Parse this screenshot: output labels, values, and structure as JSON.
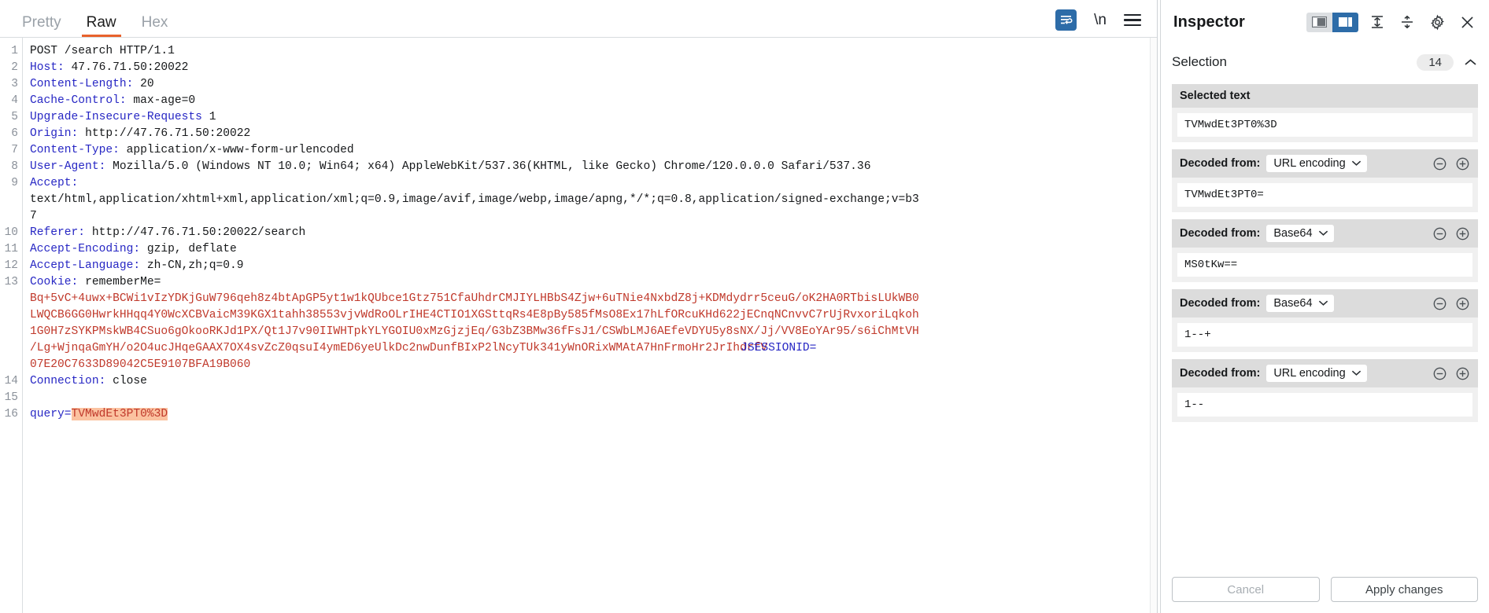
{
  "editor": {
    "tabs": [
      {
        "label": "Pretty",
        "active": false
      },
      {
        "label": "Raw",
        "active": true
      },
      {
        "label": "Hex",
        "active": false
      }
    ],
    "tools": {
      "wrap_icon": "word-wrap-icon",
      "newline_label": "\\n",
      "menu_icon": "hamburger-menu-icon"
    },
    "accent_color": "#e8622c",
    "gutter_numbers": [
      "1",
      "2",
      "3",
      "4",
      "5",
      "6",
      "7",
      "8",
      "9",
      "",
      "10",
      "11",
      "12",
      "13",
      "",
      "",
      "",
      "",
      "14",
      "15",
      "16"
    ],
    "lines": [
      {
        "n": "1",
        "type": "request",
        "method": "POST /search HTTP/1.1"
      },
      {
        "n": "2",
        "type": "header",
        "name": "Host:",
        "value": " 47.76.71.50:20022"
      },
      {
        "n": "3",
        "type": "header",
        "name": "Content-Length:",
        "value": " 20"
      },
      {
        "n": "4",
        "type": "header",
        "name": "Cache-Control:",
        "value": " max-age=0"
      },
      {
        "n": "5",
        "type": "header",
        "name": "Upgrade-Insecure-Requests",
        "value": " 1"
      },
      {
        "n": "6",
        "type": "header",
        "name": "Origin:",
        "value": " http://47.76.71.50:20022"
      },
      {
        "n": "7",
        "type": "header",
        "name": "Content-Type:",
        "value": " application/x-www-form-urlencoded"
      },
      {
        "n": "8",
        "type": "header",
        "name": "User-Agent:",
        "value": " Mozilla/5.0 (Windows NT 10.0; Win64; x64) AppleWebKit/537.36(KHTML, like Gecko) Chrome/120.0.0.0 Safari/537.36"
      },
      {
        "n": "9",
        "type": "header",
        "name": "Accept:",
        "value": ""
      },
      {
        "n": "",
        "type": "cont",
        "value": "text/html,application/xhtml+xml,application/xml;q=0.9,image/avif,image/webp,image/apng,*/*;q=0.8,application/signed-exchange;v=b3"
      },
      {
        "n": "",
        "type": "cont",
        "value": "7"
      },
      {
        "n": "10",
        "type": "header",
        "name": "Referer:",
        "value": " http://47.76.71.50:20022/search"
      },
      {
        "n": "11",
        "type": "header",
        "name": "Accept-Encoding:",
        "value": " gzip, deflate"
      },
      {
        "n": "12",
        "type": "header",
        "name": "Accept-Language:",
        "value": " zh-CN,zh;q=0.9"
      },
      {
        "n": "13",
        "type": "header",
        "name": "Cookie:",
        "value": " rememberMe="
      }
    ],
    "cookie_lines": [
      "Bq+5vC+4uwx+BCWi1vIzYDKjGuW796qeh8z4btApGP5yt1w1kQUbce1Gtz751CfaUhdrCMJIYLHBbS4Zjw+6uTNie4NxbdZ8j+KDMdydrr5ceuG/oK2HA0RTbisLUkWB0",
      "LWQCB6GG0HwrkHHqq4Y0WcXCBVaicM39KGX1tahh38553vjvWdRoOLrIHE4CTIO1XGSttqRs4E8pBy585fMsO8Ex17hLfORcuKHd622jECnqNCnvvC7rUjRvxoriLqkoh",
      "1G0H7zSYKPMskWB4CSuo6gOkooRKJd1PX/Qt1J7v90IIWHTpkYLYGOIU0xMzGjzjEq/G3bZ3BMw36fFsJ1/CSWbLMJ6AEfeVDYU5y8sNX/Jj/VV8EoYAr95/s6iChMtVH",
      "/Lg+WjnqaGmYH/o2O4ucJHqeGAAX7OX4svZcZ0qsuI4ymED6yeUlkDc2nwDunfBIxP2lNcyTUk341yWnORixWMAtA7HnFrmoHr2JrIhdrfV",
      "07E20C7633D89042C5E9107BFA19B060"
    ],
    "jsessionid_label": "JSESSIONID=",
    "tail_lines": [
      {
        "n": "14",
        "type": "header",
        "name": "Connection:",
        "value": " close"
      },
      {
        "n": "15",
        "type": "blank",
        "value": ""
      },
      {
        "n": "16",
        "type": "body",
        "name": "query=",
        "highlight": "TVMwdEt3PT0%3D"
      }
    ]
  },
  "inspector": {
    "title": "Inspector",
    "header_icons": {
      "layout_left": "layout-left-icon",
      "layout_right": "layout-right-icon",
      "expand_all": "expand-all-icon",
      "collapse_all": "collapse-all-icon",
      "settings": "gear-icon",
      "close": "close-icon"
    },
    "selection": {
      "title": "Selection",
      "count": "14",
      "collapse_icon": "chevron-up-icon"
    },
    "cards": [
      {
        "label": "Selected text",
        "type": "selected",
        "value": "TVMwdEt3PT0%3D"
      },
      {
        "label": "Decoded from:",
        "type": "decoded",
        "encoding": "URL encoding",
        "value": "TVMwdEt3PT0=",
        "minus_icon": "circle-minus-icon",
        "plus_icon": "circle-plus-icon"
      },
      {
        "label": "Decoded from:",
        "type": "decoded",
        "encoding": "Base64",
        "value": "MS0tKw==",
        "minus_icon": "circle-minus-icon",
        "plus_icon": "circle-plus-icon"
      },
      {
        "label": "Decoded from:",
        "type": "decoded",
        "encoding": "Base64",
        "value": "1--+",
        "minus_icon": "circle-minus-icon",
        "plus_icon": "circle-plus-icon"
      },
      {
        "label": "Decoded from:",
        "type": "decoded",
        "encoding": "URL encoding",
        "value": "1--",
        "minus_icon": "circle-minus-icon",
        "plus_icon": "circle-plus-icon"
      }
    ],
    "buttons": {
      "cancel": "Cancel",
      "apply": "Apply changes"
    }
  }
}
